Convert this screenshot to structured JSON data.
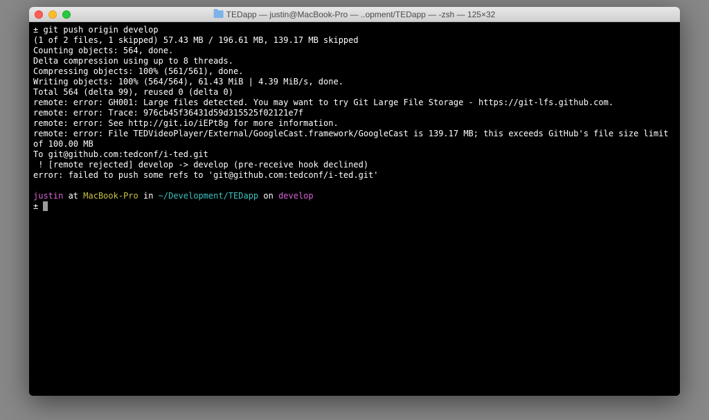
{
  "titlebar": {
    "title": "TEDapp — justin@MacBook-Pro — ..opment/TEDapp — -zsh — 125×32"
  },
  "lines": {
    "l0": "± git push origin develop",
    "l1": "(1 of 2 files, 1 skipped) 57.43 MB / 196.61 MB, 139.17 MB skipped",
    "l2": "Counting objects: 564, done.",
    "l3": "Delta compression using up to 8 threads.",
    "l4": "Compressing objects: 100% (561/561), done.",
    "l5": "Writing objects: 100% (564/564), 61.43 MiB | 4.39 MiB/s, done.",
    "l6": "Total 564 (delta 99), reused 0 (delta 0)",
    "l7": "remote: error: GH001: Large files detected. You may want to try Git Large File Storage - https://git-lfs.github.com.",
    "l8": "remote: error: Trace: 976cb45f36431d59d315525f02121e7f",
    "l9": "remote: error: See http://git.io/iEPt8g for more information.",
    "l10": "remote: error: File TEDVideoPlayer/External/GoogleCast.framework/GoogleCast is 139.17 MB; this exceeds GitHub's file size limit of 100.00 MB",
    "l11": "To git@github.com:tedconf/i-ted.git",
    "l12": " ! [remote rejected] develop -> develop (pre-receive hook declined)",
    "l13": "error: failed to push some refs to 'git@github.com:tedconf/i-ted.git'"
  },
  "prompt": {
    "user": "justin",
    "sep1": " at ",
    "host": "MacBook-Pro",
    "sep2": " in ",
    "path": "~/Development/TEDapp",
    "sep3": " on ",
    "branch": "develop",
    "symbol": "± "
  }
}
